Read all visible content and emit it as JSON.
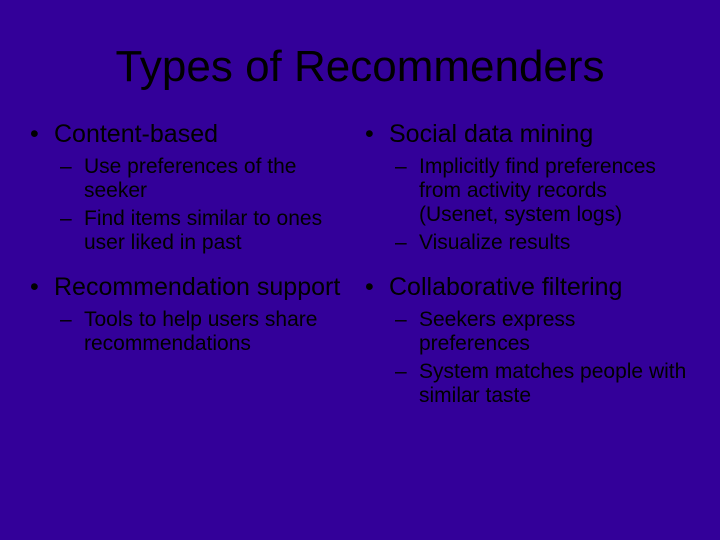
{
  "title": "Types of Recommenders",
  "left": {
    "item1": {
      "heading": "Content-based",
      "sub1": "Use preferences of the seeker",
      "sub2": "Find items similar to ones user liked in past"
    },
    "item2": {
      "heading": "Recommendation support",
      "sub1": "Tools to help users share recommendations"
    }
  },
  "right": {
    "item1": {
      "heading": "Social data mining",
      "sub1": "Implicitly find preferences from activity records (Usenet, system logs)",
      "sub2": "Visualize results"
    },
    "item2": {
      "heading": "Collaborative filtering",
      "sub1": "Seekers express preferences",
      "sub2": "System matches people with similar taste"
    }
  }
}
